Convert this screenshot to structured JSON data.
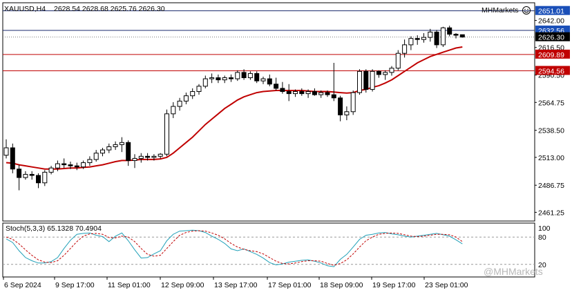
{
  "chart_data": {
    "type": "candlestick",
    "header": {
      "symbol_tf": "XAUUSD,H4",
      "ohlc": "2628.54 2628.68 2625.76 2626.30",
      "brand": "MHMarkets"
    },
    "price_axis": {
      "ylim": [
        2455,
        2656
      ],
      "ticks": [
        "2642.00",
        "2616.50",
        "2590.50",
        "2564.75",
        "2538.50",
        "2513.00",
        "2486.75",
        "2461.25"
      ]
    },
    "price_badges": [
      {
        "value": 2651.01,
        "label": "2651.01",
        "bg": "#1a4fb8",
        "fg": "#ffffff"
      },
      {
        "value": 2632.56,
        "label": "2632.56",
        "bg": "#1a4fb8",
        "fg": "#ffffff"
      },
      {
        "value": 2626.3,
        "label": "2626.30",
        "bg": "#000000",
        "fg": "#ffffff"
      },
      {
        "value": 2609.89,
        "label": "2609.89",
        "bg": "#c00000",
        "fg": "#ffffff"
      },
      {
        "value": 2594.56,
        "label": "2594.56",
        "bg": "#c00000",
        "fg": "#ffffff"
      }
    ],
    "horizontal_lines": [
      {
        "value": 2651.01,
        "color": "#1a2a6c"
      },
      {
        "value": 2632.56,
        "color": "#1a2a6c"
      },
      {
        "value": 2609.89,
        "color": "#c00000"
      },
      {
        "value": 2594.56,
        "color": "#c00000"
      }
    ],
    "bid_value": 2626.3,
    "candles": [
      [
        2515,
        2530,
        2512,
        2522
      ],
      [
        2522,
        2526,
        2498,
        2502
      ],
      [
        2502,
        2506,
        2482,
        2494
      ],
      [
        2494,
        2500,
        2492,
        2497
      ],
      [
        2497,
        2500,
        2492,
        2496
      ],
      [
        2496,
        2498,
        2484,
        2489
      ],
      [
        2489,
        2501,
        2486,
        2499
      ],
      [
        2499,
        2505,
        2497,
        2503
      ],
      [
        2503,
        2510,
        2500,
        2507
      ],
      [
        2507,
        2512,
        2503,
        2506
      ],
      [
        2506,
        2509,
        2502,
        2505
      ],
      [
        2505,
        2508,
        2501,
        2504
      ],
      [
        2504,
        2510,
        2502,
        2508
      ],
      [
        2508,
        2514,
        2505,
        2511
      ],
      [
        2511,
        2520,
        2509,
        2517
      ],
      [
        2517,
        2522,
        2514,
        2520
      ],
      [
        2520,
        2526,
        2517,
        2523
      ],
      [
        2523,
        2528,
        2520,
        2525
      ],
      [
        2525,
        2532,
        2518,
        2527
      ],
      [
        2527,
        2529,
        2505,
        2510
      ],
      [
        2510,
        2516,
        2503,
        2512
      ],
      [
        2512,
        2517,
        2508,
        2514
      ],
      [
        2514,
        2517,
        2510,
        2513
      ],
      [
        2513,
        2516,
        2510,
        2514
      ],
      [
        2514,
        2517,
        2512,
        2516
      ],
      [
        2516,
        2558,
        2514,
        2554
      ],
      [
        2554,
        2565,
        2550,
        2561
      ],
      [
        2561,
        2569,
        2557,
        2566
      ],
      [
        2566,
        2574,
        2563,
        2571
      ],
      [
        2571,
        2578,
        2568,
        2575
      ],
      [
        2575,
        2582,
        2572,
        2580
      ],
      [
        2580,
        2590,
        2578,
        2587
      ],
      [
        2587,
        2592,
        2583,
        2588
      ],
      [
        2588,
        2591,
        2583,
        2586
      ],
      [
        2586,
        2590,
        2583,
        2588
      ],
      [
        2588,
        2591,
        2584,
        2587
      ],
      [
        2587,
        2595,
        2585,
        2593
      ],
      [
        2593,
        2596,
        2586,
        2588
      ],
      [
        2588,
        2594,
        2586,
        2592
      ],
      [
        2592,
        2594,
        2583,
        2585
      ],
      [
        2585,
        2589,
        2582,
        2587
      ],
      [
        2587,
        2591,
        2580,
        2582
      ],
      [
        2582,
        2588,
        2576,
        2578
      ],
      [
        2578,
        2584,
        2573,
        2575
      ],
      [
        2575,
        2582,
        2566,
        2573
      ],
      [
        2573,
        2577,
        2570,
        2575
      ],
      [
        2575,
        2578,
        2571,
        2573
      ],
      [
        2573,
        2577,
        2569,
        2575
      ],
      [
        2575,
        2578,
        2571,
        2572
      ],
      [
        2572,
        2576,
        2569,
        2574
      ],
      [
        2574,
        2576,
        2570,
        2572
      ],
      [
        2572,
        2602,
        2566,
        2569
      ],
      [
        2569,
        2571,
        2547,
        2553
      ],
      [
        2553,
        2561,
        2548,
        2556
      ],
      [
        2556,
        2576,
        2553,
        2574
      ],
      [
        2574,
        2596,
        2572,
        2594
      ],
      [
        2594,
        2596,
        2574,
        2577
      ],
      [
        2577,
        2596,
        2575,
        2594
      ],
      [
        2594,
        2595,
        2588,
        2591
      ],
      [
        2591,
        2595,
        2586,
        2593
      ],
      [
        2593,
        2599,
        2590,
        2597
      ],
      [
        2597,
        2614,
        2595,
        2611
      ],
      [
        2611,
        2624,
        2607,
        2619
      ],
      [
        2619,
        2627,
        2614,
        2625
      ],
      [
        2625,
        2628,
        2619,
        2624
      ],
      [
        2624,
        2630,
        2621,
        2626
      ],
      [
        2626,
        2634,
        2622,
        2631
      ],
      [
        2631,
        2633,
        2616,
        2619
      ],
      [
        2619,
        2636,
        2617,
        2635
      ],
      [
        2635,
        2637,
        2627,
        2629
      ],
      [
        2629,
        2630,
        2625,
        2628
      ],
      [
        2628.54,
        2628.68,
        2625.76,
        2626.3
      ]
    ],
    "ma": {
      "period": null,
      "color": "#c00000",
      "values": [
        2508,
        2507.5,
        2506,
        2505,
        2504,
        2503,
        2502,
        2502,
        2502,
        2502.5,
        2503,
        2503,
        2503.5,
        2504,
        2505,
        2506,
        2507.5,
        2509,
        2510,
        2510,
        2510.5,
        2511,
        2511,
        2511,
        2511.5,
        2513,
        2517,
        2522,
        2527,
        2532,
        2538,
        2544,
        2549,
        2554,
        2559,
        2563,
        2567,
        2570,
        2572,
        2574,
        2575,
        2575.5,
        2576,
        2576,
        2576,
        2576,
        2576,
        2575.5,
        2575,
        2575,
        2575,
        2574.5,
        2574,
        2573.5,
        2574,
        2576,
        2577,
        2579,
        2580.5,
        2583,
        2586,
        2590,
        2594,
        2598,
        2602,
        2605,
        2608,
        2610,
        2612,
        2614,
        2616,
        2617
      ]
    },
    "stochastic": {
      "label": "Stoch(5,3,3) 65.1328 70.4904",
      "ylim": [
        0,
        100
      ],
      "levels": [
        {
          "value": 80,
          "label": "80"
        },
        {
          "value": 20,
          "label": "20"
        }
      ],
      "top_label": "100",
      "main": {
        "color": "#20a0b8",
        "values": [
          76,
          68,
          50,
          35,
          28,
          23,
          23,
          26,
          35,
          55,
          73,
          86,
          88,
          89,
          84,
          81,
          70,
          82,
          89,
          72,
          52,
          34,
          35,
          43,
          50,
          72,
          86,
          93,
          94,
          95,
          94,
          90,
          82,
          75,
          66,
          54,
          50,
          54,
          48,
          42,
          34,
          24,
          19,
          21,
          25,
          27,
          29,
          30,
          27,
          23,
          17,
          15,
          31,
          42,
          58,
          75,
          84,
          86,
          89,
          90,
          87,
          85,
          82,
          80,
          82,
          84,
          86,
          88,
          85,
          82,
          74,
          65
        ]
      },
      "signal": {
        "color": "#c00000",
        "values": [
          80,
          75,
          65,
          52,
          40,
          30,
          25,
          24,
          28,
          40,
          55,
          70,
          82,
          87,
          88,
          86,
          79,
          78,
          82,
          80,
          70,
          55,
          42,
          38,
          40,
          55,
          70,
          84,
          90,
          93,
          94,
          93,
          89,
          84,
          76,
          66,
          58,
          53,
          50,
          48,
          43,
          35,
          27,
          22,
          21,
          23,
          26,
          28,
          28,
          27,
          22,
          18,
          22,
          30,
          43,
          58,
          72,
          80,
          86,
          88,
          89,
          88,
          85,
          82,
          81,
          82,
          84,
          86,
          86,
          85,
          80,
          70
        ]
      }
    },
    "time_labels": [
      "6 Sep 2024",
      "9 Sep 17:00",
      "11 Sep 01:00",
      "12 Sep 09:00",
      "13 Sep 17:00",
      "17 Sep 01:00",
      "18 Sep 09:00",
      "19 Sep 17:00",
      "23 Sep 01:00"
    ],
    "watermark": "@MHMarkets"
  }
}
